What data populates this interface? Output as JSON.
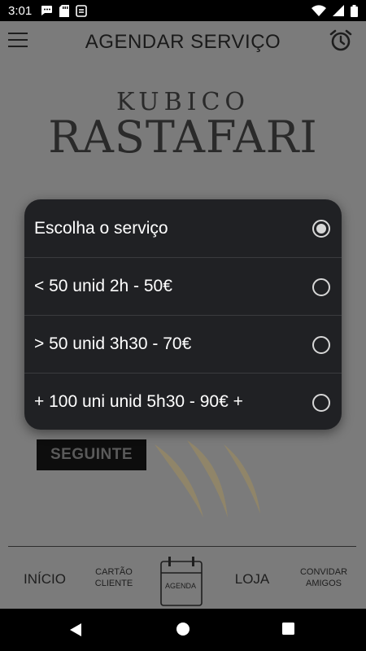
{
  "status_bar": {
    "time": "3:01",
    "left_icons": [
      "chat-icon",
      "sd-card-icon",
      "sync-icon"
    ],
    "right_icons": [
      "wifi-icon",
      "signal-icon",
      "battery-icon"
    ]
  },
  "header": {
    "title": "AGENDAR SERVIÇO",
    "menu_icon": "hamburger-menu-icon",
    "alarm_icon": "alarm-clock-icon"
  },
  "logo": {
    "top": "KUBICO",
    "bottom": "RASTAFARI"
  },
  "main": {
    "next_button": "SEGUINTE"
  },
  "service_dialog": {
    "selected_index": 0,
    "options": [
      {
        "label": "Escolha o serviço",
        "selected": true
      },
      {
        "label": "< 50 unid 2h - 50€",
        "selected": false
      },
      {
        "label": "> 50 unid 3h30 - 70€",
        "selected": false
      },
      {
        "label": "+ 100 uni unid 5h30 - 90€ +",
        "selected": false
      }
    ]
  },
  "bottom_nav": {
    "items": [
      {
        "label": "INÍCIO"
      },
      {
        "label_line1": "CARTÃO",
        "label_line2": "CLIENTE"
      },
      {
        "label": "AGENDA",
        "icon": "calendar-icon"
      },
      {
        "label": "LOJA"
      },
      {
        "label_line1": "CONVIDAR",
        "label_line2": "AMIGOS"
      }
    ]
  },
  "system_nav": {
    "buttons": [
      "back-icon",
      "home-icon",
      "recent-apps-icon"
    ]
  },
  "colors": {
    "dim_background": "#7b7b7b",
    "dialog_background": "#202124",
    "dialog_text": "#ffffff",
    "status_bar": "#000000"
  }
}
